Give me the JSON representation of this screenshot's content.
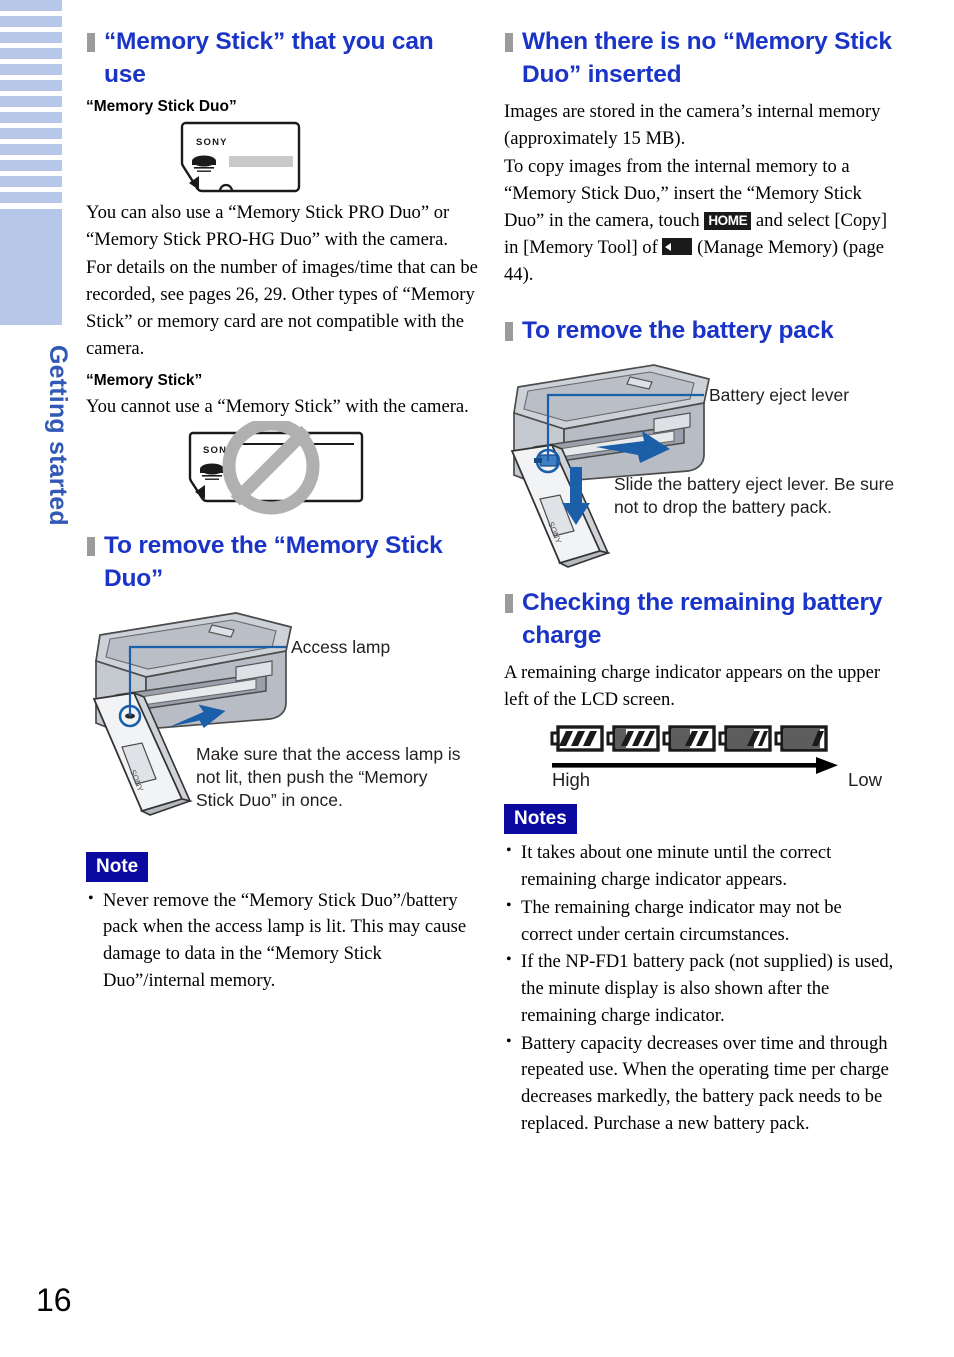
{
  "sidebar": {
    "chapter_label": "Getting started",
    "stripe_color": "#b7c7ea",
    "label_color": "#3159b5",
    "stripe_count": 13
  },
  "page": {
    "number": "16",
    "accent_heading_color": "#1a34c8",
    "note_badge_color": "#0a0aa0"
  },
  "left_column": {
    "heading1": "“Memory Stick” that you can use",
    "subheading1": "“Memory Stick Duo”",
    "figure_ms_duo": {
      "name": "memory-stick-duo-card",
      "brand": "SONY"
    },
    "para1": "You can also use a “Memory Stick PRO Duo” or “Memory Stick PRO-HG Duo” with the camera.",
    "para2": "For details on the number of images/time that can be recorded, see pages 26, 29. Other types of “Memory Stick” or memory card are not compatible with the camera.",
    "subheading2": "“Memory Stick”",
    "para3": "You cannot use a “Memory Stick” with the camera.",
    "figure_ms_prohibited": {
      "name": "memory-stick-prohibited",
      "brand": "SONY"
    },
    "heading2": "To remove the “Memory Stick Duo”",
    "figure_remove_ms": {
      "callout_label": "Access lamp",
      "caption": "Make sure that the access lamp is not lit, then push the “Memory Stick Duo” in once."
    },
    "note_badge": "Note",
    "notes": [
      "Never remove the “Memory Stick Duo”/battery pack when the access lamp is lit. This may cause damage to data in the “Memory Stick Duo”/internal memory."
    ]
  },
  "right_column": {
    "heading1": "When there is no “Memory Stick Duo” inserted",
    "para1": "Images are stored in the camera’s internal memory (approximately 15 MB).",
    "para2_a": "To copy images from the internal memory to a “Memory Stick Duo,” insert the “Memory Stick Duo” in the camera, touch",
    "home_key_label": "HOME",
    "para2_b": "and select [Copy] in [Memory Tool] of",
    "para2_c": "(Manage Memory) (page 44).",
    "heading2": "To remove the battery pack",
    "figure_battery": {
      "callout_label": "Battery eject lever",
      "caption": "Slide the battery eject lever. Be sure not to drop the battery pack."
    },
    "heading3": "Checking the remaining battery charge",
    "para3": "A remaining charge indicator appears on the upper left of the LCD screen.",
    "battery_gauge": {
      "levels": [
        0,
        1,
        2,
        3,
        4
      ],
      "filled_segments": [
        3,
        3,
        2,
        2,
        1
      ],
      "high_label": "High",
      "low_label": "Low"
    },
    "notes_badge": "Notes",
    "notes": [
      "It takes about one minute until the correct remaining charge indicator appears.",
      "The remaining charge indicator may not be correct under certain circumstances.",
      "If the NP-FD1 battery pack (not supplied) is used, the minute display is also shown after the remaining charge indicator.",
      "Battery capacity decreases over time and through repeated use. When the operating time per charge decreases markedly, the battery pack needs to be replaced. Purchase a new battery pack."
    ]
  }
}
